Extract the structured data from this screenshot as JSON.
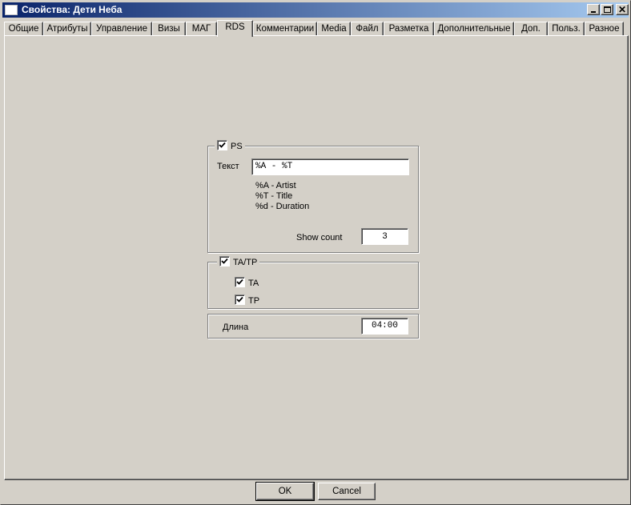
{
  "window": {
    "title": "Свойства: Дети Неба"
  },
  "tabs": [
    {
      "label": "Общие"
    },
    {
      "label": "Атрибуты"
    },
    {
      "label": "Управление"
    },
    {
      "label": "Визы"
    },
    {
      "label": "МАГ"
    },
    {
      "label": "RDS",
      "active": true
    },
    {
      "label": "Комментарии"
    },
    {
      "label": "Media"
    },
    {
      "label": "Файл"
    },
    {
      "label": "Разметка"
    },
    {
      "label": "Дополнительные"
    },
    {
      "label": "Доп."
    },
    {
      "label": "Польз."
    },
    {
      "label": "Разное"
    }
  ],
  "ps": {
    "checkbox_label": "PS",
    "checked": true,
    "text_label": "Текст",
    "text_value": "%A - %T",
    "hints": [
      "%A - Artist",
      "%T - Title",
      "%d - Duration"
    ],
    "show_count_label": "Show count",
    "show_count_value": "3"
  },
  "tatp": {
    "checkbox_label": "TA/TP",
    "checked": true,
    "ta_label": "TA",
    "ta_checked": true,
    "tp_label": "TP",
    "tp_checked": true
  },
  "length": {
    "label": "Длина",
    "value": "04:00"
  },
  "buttons": {
    "ok": "OK",
    "cancel": "Cancel"
  }
}
